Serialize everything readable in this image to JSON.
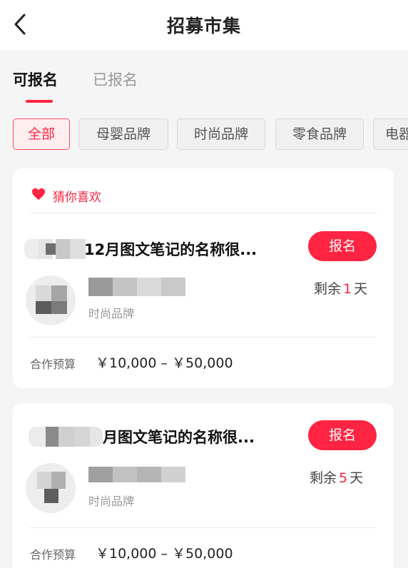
{
  "header": {
    "title": "招募市集",
    "back_icon": "chevron-left-icon"
  },
  "tabs": [
    {
      "label": "可报名",
      "active": true
    },
    {
      "label": "已报名",
      "active": false
    }
  ],
  "filters": [
    {
      "label": "全部",
      "active": true
    },
    {
      "label": "母婴品牌",
      "active": false
    },
    {
      "label": "时尚品牌",
      "active": false
    },
    {
      "label": "零食品牌",
      "active": false
    },
    {
      "label": "电器",
      "active": false
    }
  ],
  "recommend_label": "猜你喜欢",
  "cards": [
    {
      "title": "12月图文笔记的名称很...",
      "apply_label": "报名",
      "category": "时尚品牌",
      "remaining_prefix": "剩余",
      "remaining_days": "1",
      "remaining_suffix": "天",
      "budget_label": "合作预算",
      "budget_range": "￥10,000 – ￥50,000"
    },
    {
      "title": "月图文笔记的名称很...",
      "apply_label": "报名",
      "category": "时尚品牌",
      "remaining_prefix": "剩余",
      "remaining_days": "5",
      "remaining_suffix": "天",
      "budget_label": "合作预算",
      "budget_range": "￥10,000 – ￥50,000"
    }
  ],
  "colors": {
    "accent": "#ff2442",
    "background": "#f5f5f5",
    "card": "#ffffff"
  }
}
